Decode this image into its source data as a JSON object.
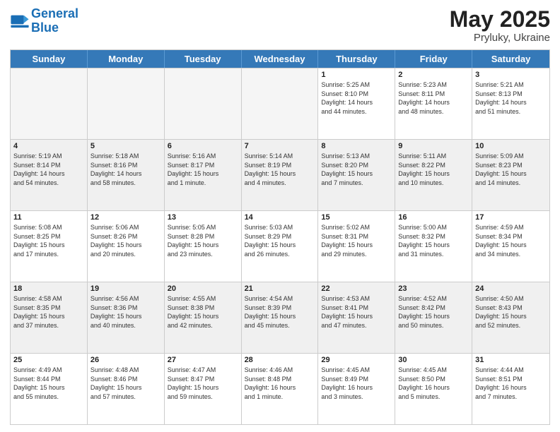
{
  "header": {
    "logo_line1": "General",
    "logo_line2": "Blue",
    "month_title": "May 2025",
    "location": "Pryluky, Ukraine"
  },
  "weekdays": [
    "Sunday",
    "Monday",
    "Tuesday",
    "Wednesday",
    "Thursday",
    "Friday",
    "Saturday"
  ],
  "rows": [
    [
      {
        "day": "",
        "info": "",
        "empty": true
      },
      {
        "day": "",
        "info": "",
        "empty": true
      },
      {
        "day": "",
        "info": "",
        "empty": true
      },
      {
        "day": "",
        "info": "",
        "empty": true
      },
      {
        "day": "1",
        "info": "Sunrise: 5:25 AM\nSunset: 8:10 PM\nDaylight: 14 hours\nand 44 minutes.",
        "empty": false
      },
      {
        "day": "2",
        "info": "Sunrise: 5:23 AM\nSunset: 8:11 PM\nDaylight: 14 hours\nand 48 minutes.",
        "empty": false
      },
      {
        "day": "3",
        "info": "Sunrise: 5:21 AM\nSunset: 8:13 PM\nDaylight: 14 hours\nand 51 minutes.",
        "empty": false
      }
    ],
    [
      {
        "day": "4",
        "info": "Sunrise: 5:19 AM\nSunset: 8:14 PM\nDaylight: 14 hours\nand 54 minutes.",
        "empty": false
      },
      {
        "day": "5",
        "info": "Sunrise: 5:18 AM\nSunset: 8:16 PM\nDaylight: 14 hours\nand 58 minutes.",
        "empty": false
      },
      {
        "day": "6",
        "info": "Sunrise: 5:16 AM\nSunset: 8:17 PM\nDaylight: 15 hours\nand 1 minute.",
        "empty": false
      },
      {
        "day": "7",
        "info": "Sunrise: 5:14 AM\nSunset: 8:19 PM\nDaylight: 15 hours\nand 4 minutes.",
        "empty": false
      },
      {
        "day": "8",
        "info": "Sunrise: 5:13 AM\nSunset: 8:20 PM\nDaylight: 15 hours\nand 7 minutes.",
        "empty": false
      },
      {
        "day": "9",
        "info": "Sunrise: 5:11 AM\nSunset: 8:22 PM\nDaylight: 15 hours\nand 10 minutes.",
        "empty": false
      },
      {
        "day": "10",
        "info": "Sunrise: 5:09 AM\nSunset: 8:23 PM\nDaylight: 15 hours\nand 14 minutes.",
        "empty": false
      }
    ],
    [
      {
        "day": "11",
        "info": "Sunrise: 5:08 AM\nSunset: 8:25 PM\nDaylight: 15 hours\nand 17 minutes.",
        "empty": false
      },
      {
        "day": "12",
        "info": "Sunrise: 5:06 AM\nSunset: 8:26 PM\nDaylight: 15 hours\nand 20 minutes.",
        "empty": false
      },
      {
        "day": "13",
        "info": "Sunrise: 5:05 AM\nSunset: 8:28 PM\nDaylight: 15 hours\nand 23 minutes.",
        "empty": false
      },
      {
        "day": "14",
        "info": "Sunrise: 5:03 AM\nSunset: 8:29 PM\nDaylight: 15 hours\nand 26 minutes.",
        "empty": false
      },
      {
        "day": "15",
        "info": "Sunrise: 5:02 AM\nSunset: 8:31 PM\nDaylight: 15 hours\nand 29 minutes.",
        "empty": false
      },
      {
        "day": "16",
        "info": "Sunrise: 5:00 AM\nSunset: 8:32 PM\nDaylight: 15 hours\nand 31 minutes.",
        "empty": false
      },
      {
        "day": "17",
        "info": "Sunrise: 4:59 AM\nSunset: 8:34 PM\nDaylight: 15 hours\nand 34 minutes.",
        "empty": false
      }
    ],
    [
      {
        "day": "18",
        "info": "Sunrise: 4:58 AM\nSunset: 8:35 PM\nDaylight: 15 hours\nand 37 minutes.",
        "empty": false
      },
      {
        "day": "19",
        "info": "Sunrise: 4:56 AM\nSunset: 8:36 PM\nDaylight: 15 hours\nand 40 minutes.",
        "empty": false
      },
      {
        "day": "20",
        "info": "Sunrise: 4:55 AM\nSunset: 8:38 PM\nDaylight: 15 hours\nand 42 minutes.",
        "empty": false
      },
      {
        "day": "21",
        "info": "Sunrise: 4:54 AM\nSunset: 8:39 PM\nDaylight: 15 hours\nand 45 minutes.",
        "empty": false
      },
      {
        "day": "22",
        "info": "Sunrise: 4:53 AM\nSunset: 8:41 PM\nDaylight: 15 hours\nand 47 minutes.",
        "empty": false
      },
      {
        "day": "23",
        "info": "Sunrise: 4:52 AM\nSunset: 8:42 PM\nDaylight: 15 hours\nand 50 minutes.",
        "empty": false
      },
      {
        "day": "24",
        "info": "Sunrise: 4:50 AM\nSunset: 8:43 PM\nDaylight: 15 hours\nand 52 minutes.",
        "empty": false
      }
    ],
    [
      {
        "day": "25",
        "info": "Sunrise: 4:49 AM\nSunset: 8:44 PM\nDaylight: 15 hours\nand 55 minutes.",
        "empty": false
      },
      {
        "day": "26",
        "info": "Sunrise: 4:48 AM\nSunset: 8:46 PM\nDaylight: 15 hours\nand 57 minutes.",
        "empty": false
      },
      {
        "day": "27",
        "info": "Sunrise: 4:47 AM\nSunset: 8:47 PM\nDaylight: 15 hours\nand 59 minutes.",
        "empty": false
      },
      {
        "day": "28",
        "info": "Sunrise: 4:46 AM\nSunset: 8:48 PM\nDaylight: 16 hours\nand 1 minute.",
        "empty": false
      },
      {
        "day": "29",
        "info": "Sunrise: 4:45 AM\nSunset: 8:49 PM\nDaylight: 16 hours\nand 3 minutes.",
        "empty": false
      },
      {
        "day": "30",
        "info": "Sunrise: 4:45 AM\nSunset: 8:50 PM\nDaylight: 16 hours\nand 5 minutes.",
        "empty": false
      },
      {
        "day": "31",
        "info": "Sunrise: 4:44 AM\nSunset: 8:51 PM\nDaylight: 16 hours\nand 7 minutes.",
        "empty": false
      }
    ]
  ]
}
